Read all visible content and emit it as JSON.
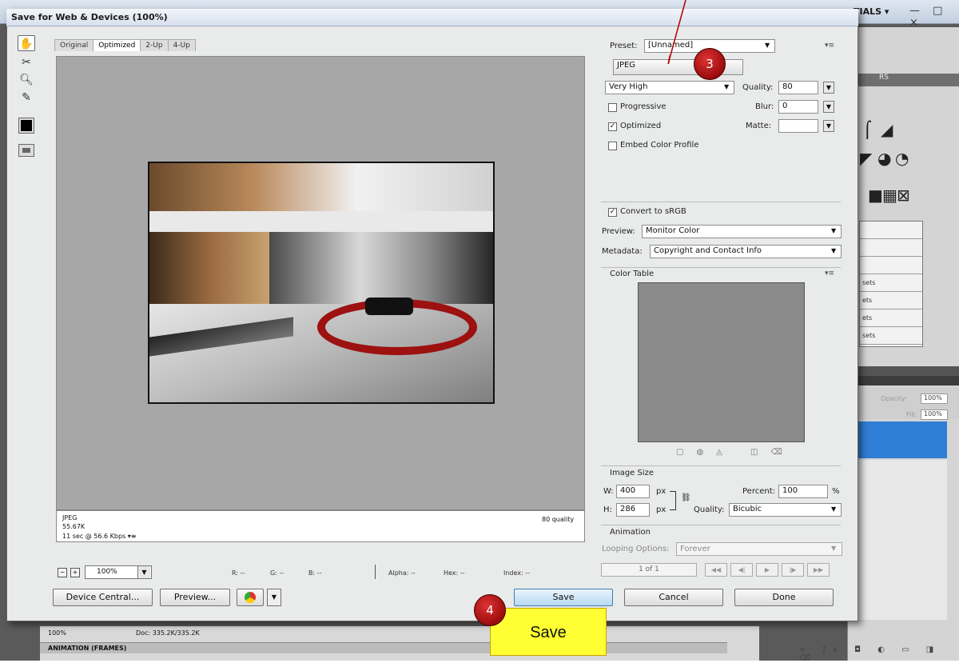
{
  "photoshop": {
    "workspace_label": "TIALS ▾",
    "window_controls": "— □ ×",
    "status_zoom": "100%",
    "status_doc": "Doc: 335.2K/335.2K",
    "animation_panel": "ANIMATION (FRAMES)",
    "layers_opacity_label": "Opacity:",
    "layers_opacity_value": "100%",
    "layers_fill_label": "Fill:",
    "layers_fill_value": "100%",
    "preset_rows": [
      "",
      "",
      "",
      "sets",
      "ets",
      "ets",
      "sets"
    ]
  },
  "dialog": {
    "title": "Save for Web & Devices (100%)",
    "tabs": [
      "Original",
      "Optimized",
      "2-Up",
      "4-Up"
    ],
    "active_tab": "Optimized",
    "info": {
      "format": "JPEG",
      "size": "55.67K",
      "time": "11 sec @ 56.6 Kbps",
      "quality": "80 quality"
    },
    "zoom": {
      "value": "100%",
      "minus": "−",
      "plus": "+"
    },
    "readouts": {
      "r": "R: --",
      "g": "G: --",
      "b": "B: --",
      "alpha": "Alpha: --",
      "hex": "Hex: --",
      "index": "Index: --"
    },
    "buttons": {
      "device_central": "Device Central...",
      "preview": "Preview...",
      "save": "Save",
      "cancel": "Cancel",
      "done": "Done"
    }
  },
  "settings": {
    "preset_label": "Preset:",
    "preset_value": "[Unnamed]",
    "format_value": "JPEG",
    "compression_value": "Very High",
    "quality_label": "Quality:",
    "quality_value": "80",
    "blur_label": "Blur:",
    "blur_value": "0",
    "matte_label": "Matte:",
    "matte_value": "",
    "progressive_label": "Progressive",
    "progressive_checked": false,
    "optimized_label": "Optimized",
    "optimized_checked": true,
    "embed_label": "Embed Color Profile",
    "embed_checked": false,
    "convert_label": "Convert to sRGB",
    "convert_checked": true,
    "preview_label": "Preview:",
    "preview_value": "Monitor Color",
    "metadata_label": "Metadata:",
    "metadata_value": "Copyright and Contact Info",
    "color_table_label": "Color Table",
    "image_size": {
      "label": "Image Size",
      "w_label": "W:",
      "w_value": "400",
      "h_label": "H:",
      "h_value": "286",
      "unit": "px",
      "percent_label": "Percent:",
      "percent_value": "100",
      "percent_unit": "%",
      "quality_label": "Quality:",
      "quality_value": "Bicubic"
    },
    "animation": {
      "label": "Animation",
      "looping_label": "Looping Options:",
      "looping_value": "Forever",
      "frame_counter": "1 of 1"
    }
  },
  "annotations": {
    "callout_3": "3",
    "callout_4": "4",
    "save_tag": "Save",
    "callout_color": "#a80f0f",
    "tag_color": "#ffff33"
  },
  "colors": {
    "preview_bg": "#a7a7a7",
    "save_button": "#b9d9f1",
    "layer_selected": "#2f7fd6"
  }
}
